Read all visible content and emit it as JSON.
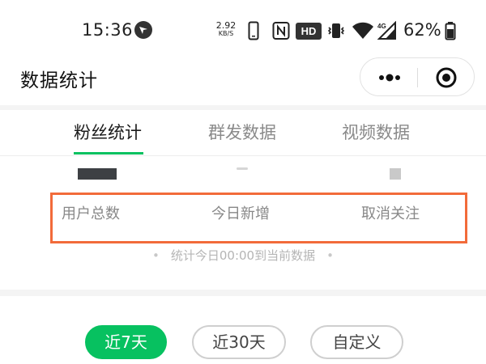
{
  "status_bar": {
    "time": "15:36",
    "net_speed_value": "2.92",
    "net_speed_unit": "KB/S",
    "hd_label": "HD",
    "network_type": "4G",
    "battery_percent": "62%"
  },
  "title_bar": {
    "title": "数据统计"
  },
  "tabs": [
    {
      "label": "粉丝统计",
      "active": true
    },
    {
      "label": "群发数据",
      "active": false
    },
    {
      "label": "视频数据",
      "active": false
    }
  ],
  "stats": {
    "labels": [
      "用户总数",
      "今日新增",
      "取消关注"
    ],
    "note": "统计今日00:00到当前数据"
  },
  "range_buttons": [
    {
      "label": "近7天",
      "active": true
    },
    {
      "label": "近30天",
      "active": false
    },
    {
      "label": "自定义",
      "active": false
    }
  ],
  "colors": {
    "accent": "#07c160",
    "highlight_border": "#f26b3a"
  }
}
